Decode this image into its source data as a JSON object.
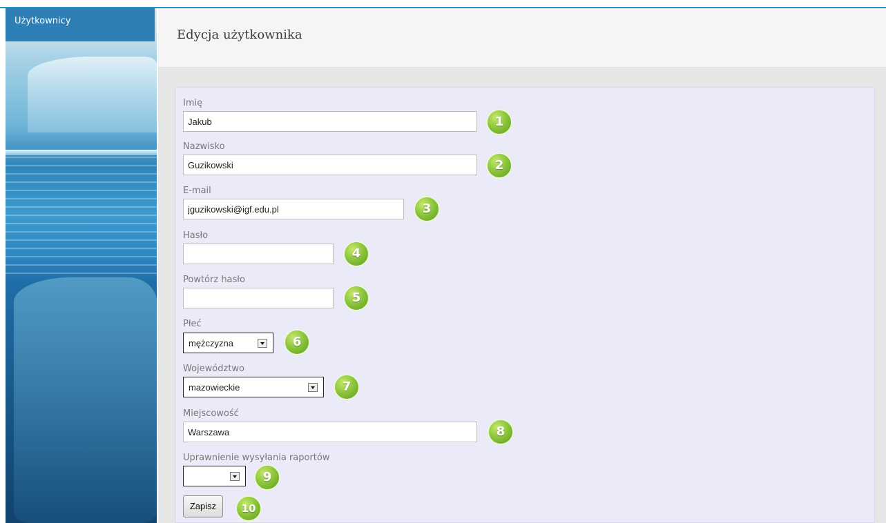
{
  "sidebar": {
    "tab_label": "Użytkownicy"
  },
  "header": {
    "title": "Edycja użytkownika"
  },
  "form": {
    "first_name": {
      "label": "Imię",
      "value": "Jakub",
      "badge": "1"
    },
    "last_name": {
      "label": "Nazwisko",
      "value": "Guzikowski",
      "badge": "2"
    },
    "email": {
      "label": "E-mail",
      "value": "jguzikowski@igf.edu.pl",
      "badge": "3"
    },
    "password": {
      "label": "Hasło",
      "value": "",
      "badge": "4"
    },
    "password_repeat": {
      "label": "Powtórz hasło",
      "value": "",
      "badge": "5"
    },
    "gender": {
      "label": "Płeć",
      "selected": "mężczyzna",
      "badge": "6"
    },
    "voivodeship": {
      "label": "Województwo",
      "selected": "mazowieckie",
      "badge": "7"
    },
    "city": {
      "label": "Miejscowość",
      "value": "Warszawa",
      "badge": "8"
    },
    "report_permission": {
      "label": "Uprawnienie wysyłania raportów",
      "selected": "",
      "badge": "9"
    },
    "save": {
      "label": "Zapisz",
      "badge": "10"
    }
  },
  "colors": {
    "accent": "#2b8fc6",
    "sidebar_tab": "#2f7fb7",
    "form_panel": "#eaeaf9",
    "badge_green": "#8dc63f"
  },
  "icons": {
    "dropdown_arrow": "chevron-down-icon",
    "badges": "number-badge-icon"
  }
}
